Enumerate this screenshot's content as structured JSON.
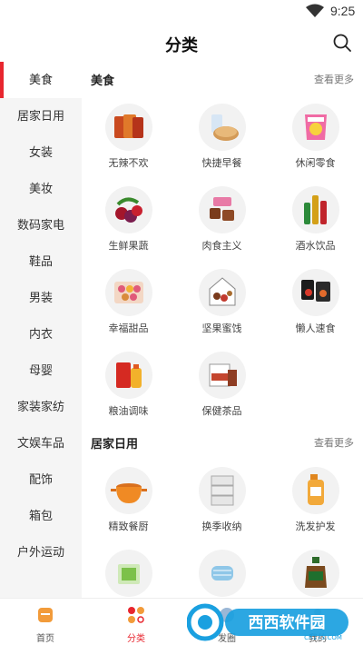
{
  "status_bar": {
    "time": "9:25"
  },
  "header": {
    "title": "分类"
  },
  "sidebar": {
    "items": [
      {
        "label": "美食",
        "active": true
      },
      {
        "label": "居家日用"
      },
      {
        "label": "女装"
      },
      {
        "label": "美妆"
      },
      {
        "label": "数码家电"
      },
      {
        "label": "鞋品"
      },
      {
        "label": "男装"
      },
      {
        "label": "内衣"
      },
      {
        "label": "母婴"
      },
      {
        "label": "家装家纺"
      },
      {
        "label": "文娱车品"
      },
      {
        "label": "配饰"
      },
      {
        "label": "箱包"
      },
      {
        "label": "户外运动"
      }
    ]
  },
  "sections": [
    {
      "title": "美食",
      "more": "查看更多",
      "items": [
        {
          "label": "无辣不欢",
          "icon": "spicy-snack-icon"
        },
        {
          "label": "快捷早餐",
          "icon": "bread-icon"
        },
        {
          "label": "休闲零食",
          "icon": "chips-icon"
        },
        {
          "label": "生鲜果蔬",
          "icon": "fruit-icon"
        },
        {
          "label": "肉食主义",
          "icon": "meat-icon"
        },
        {
          "label": "酒水饮品",
          "icon": "drinks-icon"
        },
        {
          "label": "幸福甜品",
          "icon": "dessert-icon"
        },
        {
          "label": "坚果蜜饯",
          "icon": "nuts-icon"
        },
        {
          "label": "懒人速食",
          "icon": "instant-noodle-icon"
        },
        {
          "label": "粮油调味",
          "icon": "oil-icon"
        },
        {
          "label": "保健茶品",
          "icon": "tea-icon"
        }
      ]
    },
    {
      "title": "居家日用",
      "more": "查看更多",
      "items": [
        {
          "label": "精致餐厨",
          "icon": "pot-icon"
        },
        {
          "label": "换季收纳",
          "icon": "storage-drawer-icon"
        },
        {
          "label": "洗发护发",
          "icon": "shampoo-icon"
        },
        {
          "label": "",
          "icon": "tissue-icon"
        },
        {
          "label": "",
          "icon": "mask-icon"
        },
        {
          "label": "",
          "icon": "disinfectant-icon"
        }
      ]
    }
  ],
  "bottom_nav": {
    "items": [
      {
        "label": "首页",
        "icon": "home-icon"
      },
      {
        "label": "分类",
        "icon": "category-icon",
        "active": true
      },
      {
        "label": "发圈",
        "icon": "share-icon"
      },
      {
        "label": "我的",
        "icon": "profile-icon"
      }
    ]
  },
  "watermark": {
    "text": "西西软件园",
    "sub": "CR173.COM"
  },
  "colors": {
    "accent": "#e8262f",
    "sidebar_bg": "#f5f5f5"
  }
}
